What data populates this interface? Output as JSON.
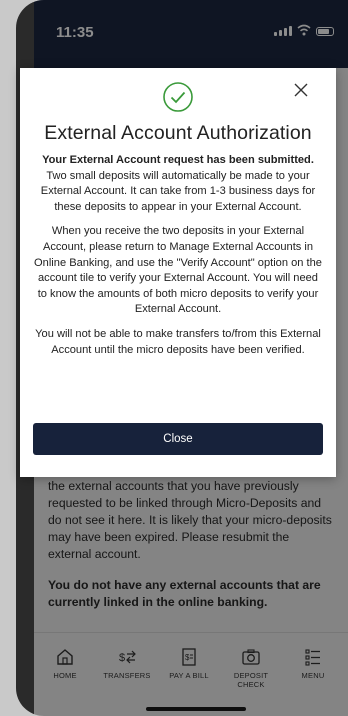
{
  "status_bar": {
    "time": "11:35"
  },
  "modal": {
    "title": "External Account Authorization",
    "heading_bold": "Your External Account request has been submitted.",
    "paragraph1_rest": " Two small deposits will automatically be made to your External Account. It can take from 1-3 business days for these deposits to appear in your External Account.",
    "paragraph2": "When you receive the two deposits in your External Account, please return to Manage External Accounts in Online Banking, and use the \"Verify Account\" option on the account tile to verify your External Account. You will need to know the amounts of both micro deposits to verify your External Account.",
    "paragraph3": "You will not be able to make transfers to/from this External Account until the micro deposits have been verified.",
    "close_button": "Close"
  },
  "background": {
    "paragraph": "the external accounts that you have previously requested to be linked through Micro-Deposits and do not see it here. It is likely that your micro-deposits may have been expired. Please resubmit the external account.",
    "bold_paragraph": "You do not have any external accounts that are currently linked in the online banking."
  },
  "tabbar": {
    "items": [
      {
        "label": "HOME",
        "icon": "home-icon"
      },
      {
        "label": "TRANSFERS",
        "icon": "transfers-icon"
      },
      {
        "label": "PAY A BILL",
        "icon": "bill-icon"
      },
      {
        "label": "DEPOSIT CHECK",
        "icon": "camera-icon"
      },
      {
        "label": "MENU",
        "icon": "menu-icon"
      }
    ]
  },
  "colors": {
    "navy": "#17223b",
    "success_green": "#3a9a3a"
  }
}
